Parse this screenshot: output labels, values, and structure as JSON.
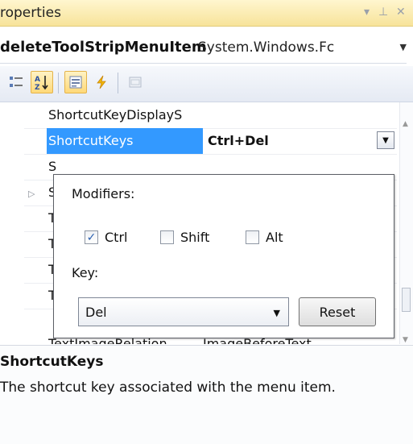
{
  "window": {
    "title": "roperties"
  },
  "object_selector": {
    "name": "deleteToolStripMenuItem",
    "type": "System.Windows.Fc"
  },
  "grid": {
    "rows": [
      {
        "name": "ShortcutKeyDisplayS",
        "value": ""
      },
      {
        "name": "ShortcutKeys",
        "value": "Ctrl+Del"
      },
      {
        "name": "S",
        "value": ""
      },
      {
        "name": "S",
        "value": ""
      },
      {
        "name": "T",
        "value": ""
      },
      {
        "name": "T",
        "value": ""
      },
      {
        "name": "T",
        "value": ""
      },
      {
        "name": "T",
        "value": ""
      },
      {
        "name": "TextImageRelation",
        "value": "ImageBeforeText"
      }
    ]
  },
  "editor": {
    "modifiers_label": "Modifiers:",
    "ctrl": {
      "label": "Ctrl",
      "checked": true
    },
    "shift": {
      "label": "Shift",
      "checked": false
    },
    "alt": {
      "label": "Alt",
      "checked": false
    },
    "key_label": "Key:",
    "key_value": "Del",
    "reset_label": "Reset"
  },
  "description": {
    "title": "ShortcutKeys",
    "text": "The shortcut key associated with the menu item."
  },
  "colors": {
    "selection": "#3399ff",
    "titlebar": "#f7e39a"
  }
}
